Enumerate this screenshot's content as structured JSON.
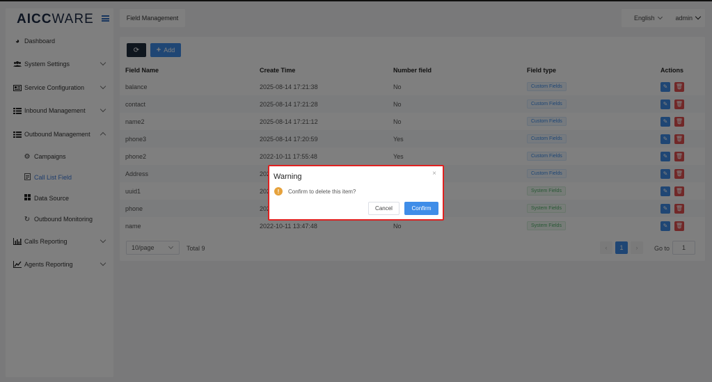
{
  "brand": {
    "part1": "AICC",
    "part2": "WARE"
  },
  "sidebar": {
    "items": [
      {
        "label": "Dashboard",
        "icon": "dashboard-icon",
        "has_chevron": false
      },
      {
        "label": "System Settings",
        "icon": "users-icon",
        "has_chevron": true
      },
      {
        "label": "Service Configuration",
        "icon": "id-card-icon",
        "has_chevron": true
      },
      {
        "label": "Inbound Management",
        "icon": "list-icon",
        "has_chevron": true
      },
      {
        "label": "Outbound Management",
        "icon": "list-icon",
        "has_chevron": true,
        "expanded": true
      },
      {
        "label": "Calls Reporting",
        "icon": "bar-chart-icon",
        "has_chevron": true
      },
      {
        "label": "Agents Reporting",
        "icon": "line-chart-icon",
        "has_chevron": true
      }
    ],
    "subitems": [
      {
        "label": "Campaigns",
        "icon": "gear-icon"
      },
      {
        "label": "Call List Field",
        "icon": "document-icon",
        "active": true
      },
      {
        "label": "Data Source",
        "icon": "grid-icon"
      },
      {
        "label": "Outbound Monitoring",
        "icon": "refresh-icon"
      }
    ]
  },
  "header": {
    "tab": "Field Management",
    "language": "English",
    "user": "admin"
  },
  "toolbar": {
    "add_label": "Add"
  },
  "table": {
    "columns": [
      "Field Name",
      "Create Time",
      "Number field",
      "Field type",
      "Actions"
    ],
    "rows": [
      {
        "name": "balance",
        "time": "2025-08-14 17:21:38",
        "number": "No",
        "type": "Custom Fields",
        "kind": "custom"
      },
      {
        "name": "contact",
        "time": "2025-08-14 17:21:28",
        "number": "No",
        "type": "Custom Fields",
        "kind": "custom"
      },
      {
        "name": "name2",
        "time": "2025-08-14 17:21:12",
        "number": "No",
        "type": "Custom Fields",
        "kind": "custom"
      },
      {
        "name": "phone3",
        "time": "2025-08-14 17:20:59",
        "number": "Yes",
        "type": "Custom Fields",
        "kind": "custom"
      },
      {
        "name": "phone2",
        "time": "2022-10-11 17:55:48",
        "number": "Yes",
        "type": "Custom Fields",
        "kind": "custom"
      },
      {
        "name": "Address",
        "time": "202",
        "number": "",
        "type": "Custom Fields",
        "kind": "custom"
      },
      {
        "name": "uuid1",
        "time": "202",
        "number": "",
        "type": "System Fields",
        "kind": "system"
      },
      {
        "name": "phone",
        "time": "202",
        "number": "",
        "type": "System Fields",
        "kind": "system"
      },
      {
        "name": "name",
        "time": "2022-10-11 13:47:48",
        "number": "No",
        "type": "System Fields",
        "kind": "system"
      }
    ]
  },
  "pagination": {
    "page_size": "10/page",
    "total": "Total 9",
    "current": "1",
    "goto_label": "Go to",
    "goto_value": "1"
  },
  "dialog": {
    "title": "Warning",
    "message": "Confirm to delete this item?",
    "cancel": "Cancel",
    "confirm": "Confirm",
    "close": "×"
  },
  "colors": {
    "primary": "#3f8de8",
    "danger": "#e35050",
    "highlight_border": "#e0201f",
    "warning": "#e6a23c"
  }
}
